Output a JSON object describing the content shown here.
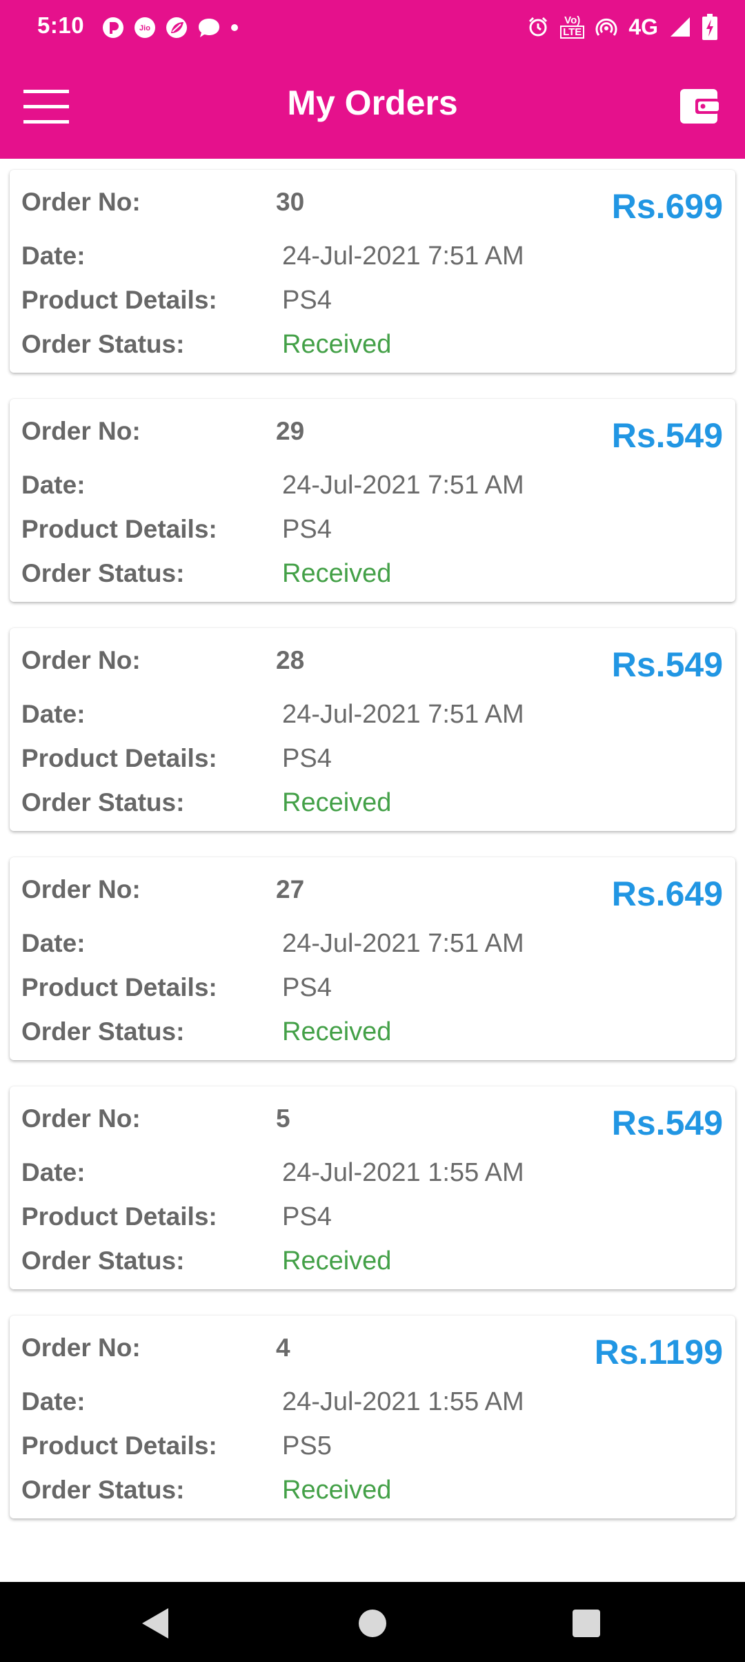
{
  "status_bar": {
    "time": "5:10",
    "jio_label": "Jio",
    "volte_top": "Vo)",
    "volte_bottom": "LTE",
    "network": "4G",
    "notification_icons": [
      "pinwheel-icon",
      "jio-icon",
      "leaf-icon",
      "chat-bubble-icon",
      "dot-icon"
    ],
    "status_icons": [
      "alarm-icon",
      "volte-icon",
      "hotspot-icon",
      "signal-icon",
      "battery-charging-icon"
    ]
  },
  "toolbar": {
    "title": "My Orders",
    "menu_icon": "hamburger-menu-icon",
    "action_icon": "wallet-icon"
  },
  "labels": {
    "order_no": "Order No:",
    "date": "Date:",
    "product_details": "Product Details:",
    "order_status": "Order Status:"
  },
  "orders": [
    {
      "order_no": "30",
      "price": "Rs.699",
      "date": "24-Jul-2021 7:51 AM",
      "product": "PS4",
      "status": "Received"
    },
    {
      "order_no": "29",
      "price": "Rs.549",
      "date": "24-Jul-2021 7:51 AM",
      "product": "PS4",
      "status": "Received"
    },
    {
      "order_no": "28",
      "price": "Rs.549",
      "date": "24-Jul-2021 7:51 AM",
      "product": "PS4",
      "status": "Received"
    },
    {
      "order_no": "27",
      "price": "Rs.649",
      "date": "24-Jul-2021 7:51 AM",
      "product": "PS4",
      "status": "Received"
    },
    {
      "order_no": "5",
      "price": "Rs.549",
      "date": "24-Jul-2021 1:55 AM",
      "product": "PS4",
      "status": "Received"
    },
    {
      "order_no": "4",
      "price": "Rs.1199",
      "date": "24-Jul-2021 1:55 AM",
      "product": "PS5",
      "status": "Received"
    }
  ],
  "nav_bar": {
    "icons": [
      "back-triangle-icon",
      "home-circle-icon",
      "recents-square-icon"
    ]
  },
  "colors": {
    "app_bar": "#e5118c",
    "price": "#2196e3",
    "status_received": "#43a047",
    "label_text": "#676767",
    "nav_bar": "#000000"
  }
}
